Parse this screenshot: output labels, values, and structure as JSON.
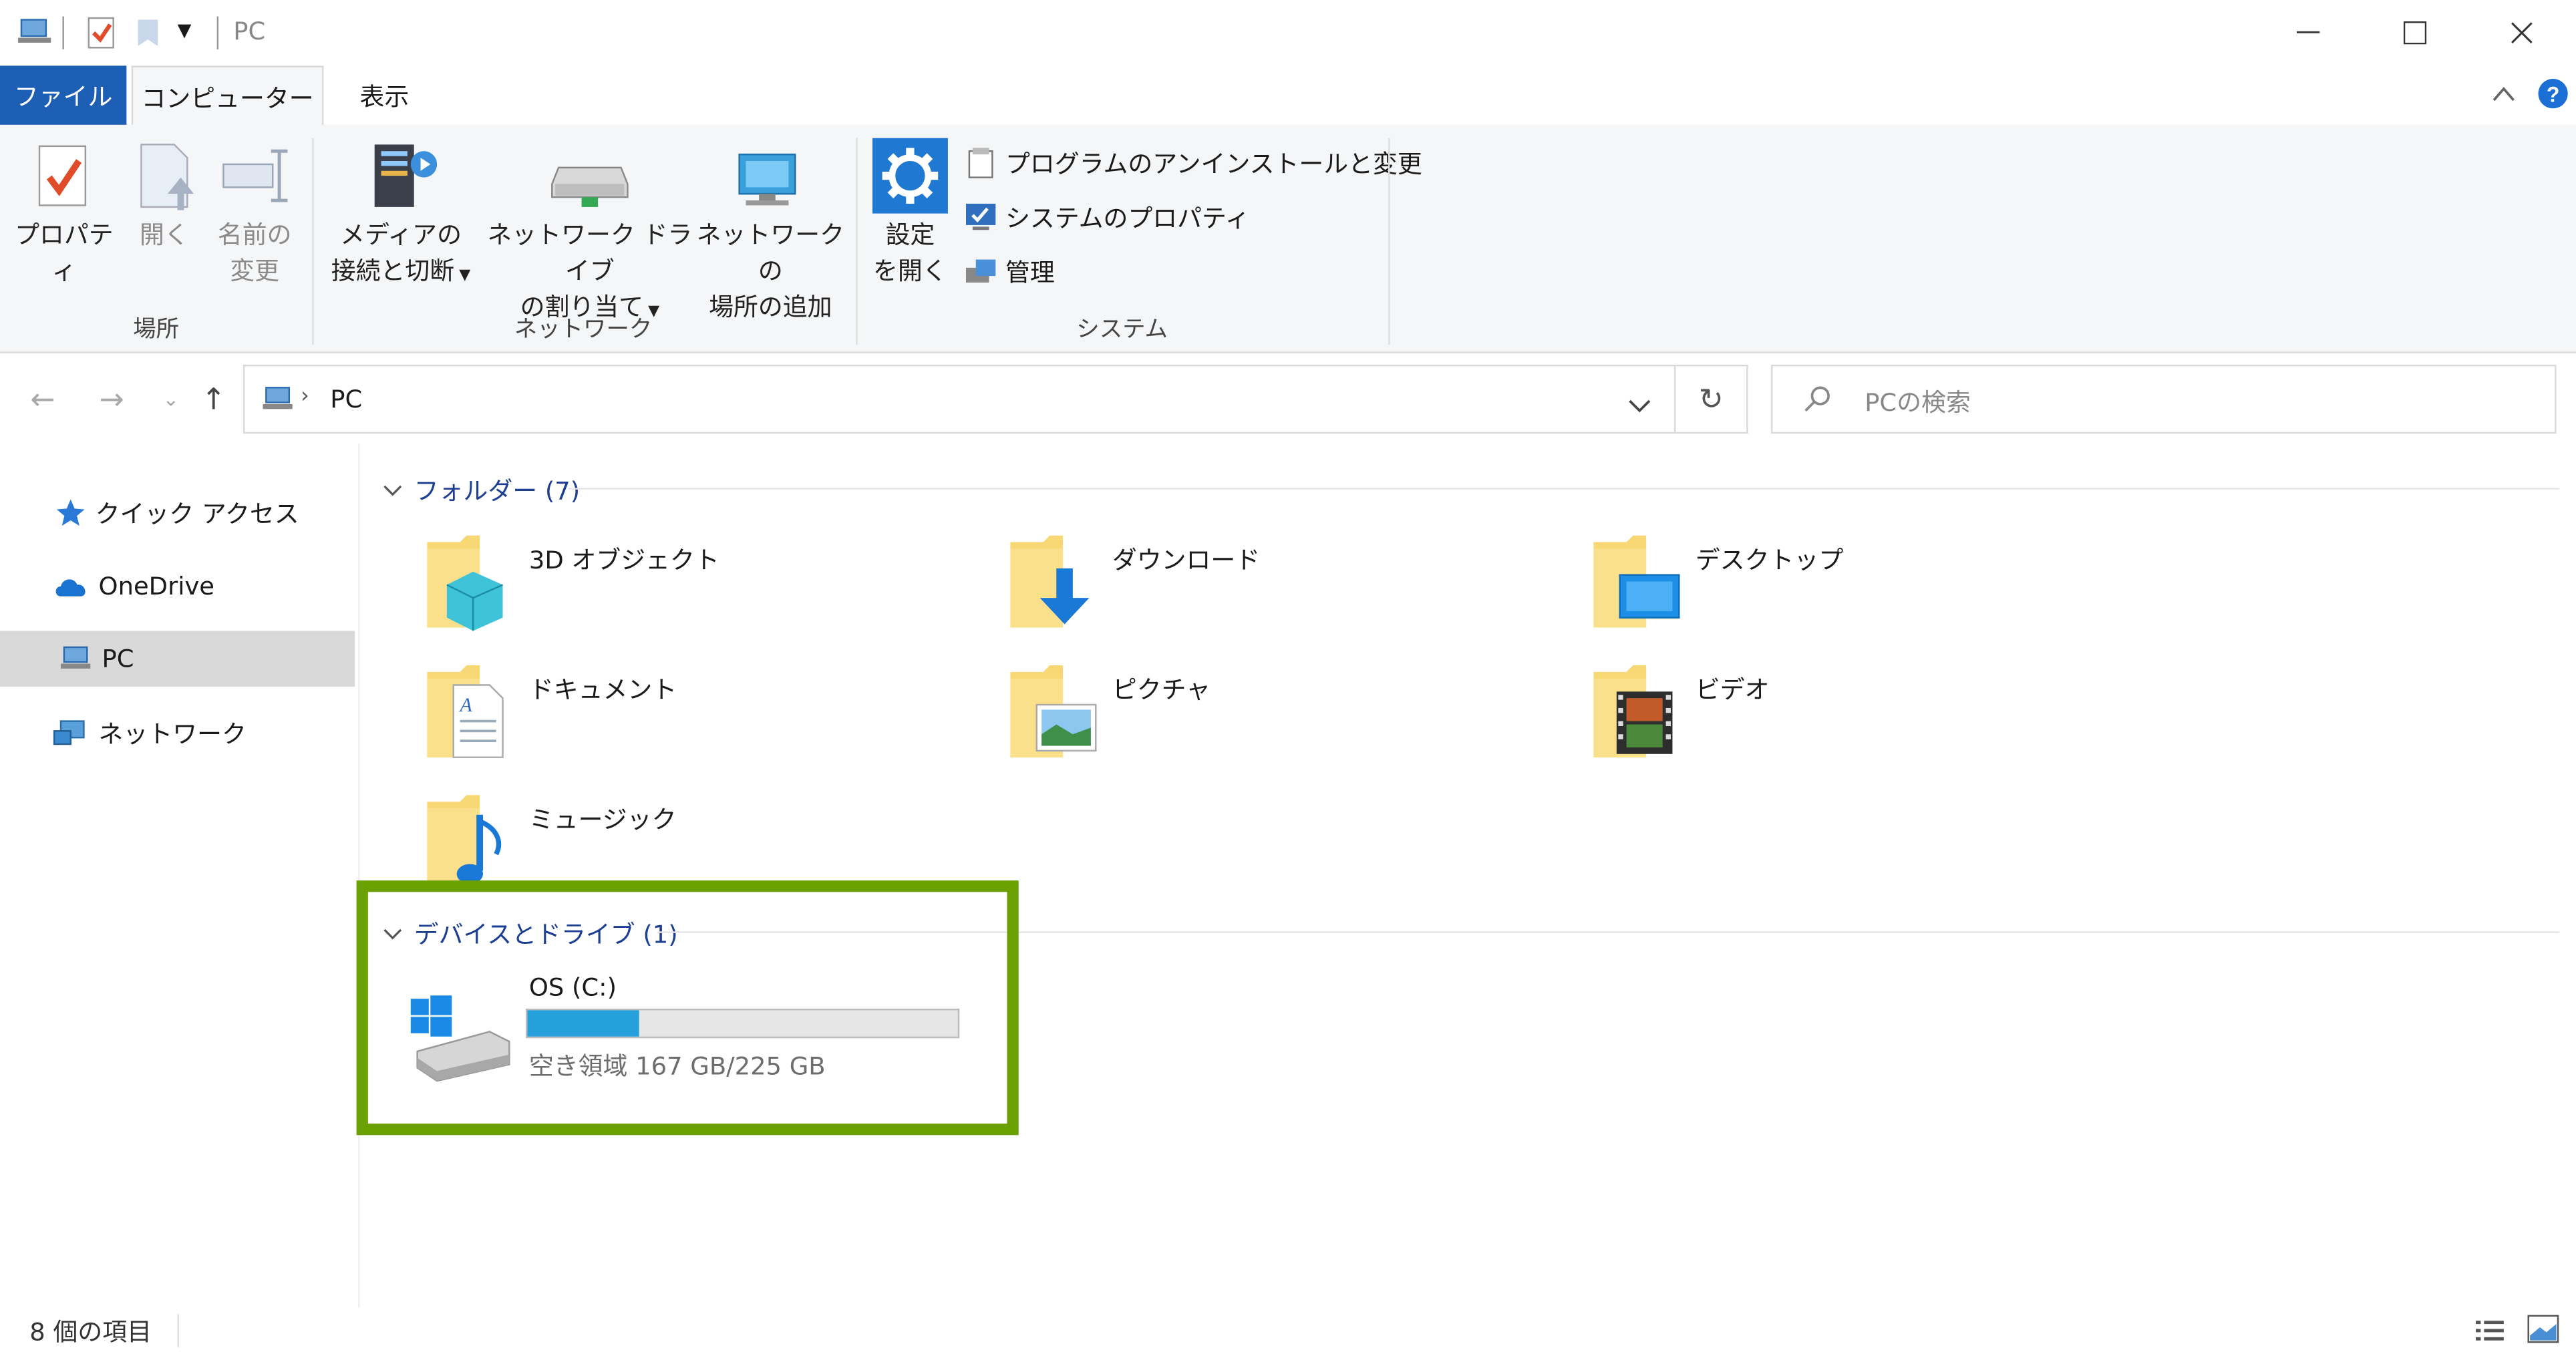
{
  "window": {
    "title": "PC"
  },
  "tabs": {
    "file": "ファイル",
    "computer": "コンピューター",
    "view": "表示"
  },
  "ribbon": {
    "properties": [
      "プロパティ"
    ],
    "open": [
      "開く"
    ],
    "rename": [
      "名前の",
      "変更"
    ],
    "media": [
      "メディアの",
      "接続と切断"
    ],
    "mapdrive": [
      "ネットワーク ドライブ",
      "の割り当て"
    ],
    "addnet": [
      "ネットワークの",
      "場所の追加"
    ],
    "settings": [
      "設定",
      "を開く"
    ],
    "uninstall": "プログラムのアンインストールと変更",
    "sysprops": "システムのプロパティ",
    "manage": "管理",
    "groups": {
      "location": "場所",
      "network": "ネットワーク",
      "system": "システム"
    }
  },
  "address": {
    "path": "PC",
    "search_placeholder": "PCの検索"
  },
  "nav": {
    "quick": "クイック アクセス",
    "onedrive": "OneDrive",
    "pc": "PC",
    "network": "ネットワーク"
  },
  "folders_header": "フォルダー (7)",
  "folders": [
    "3D オブジェクト",
    "ダウンロード",
    "デスクトップ",
    "ドキュメント",
    "ピクチャ",
    "ビデオ",
    "ミュージック"
  ],
  "devices_header": "デバイスとドライブ (1)",
  "drive": {
    "name": "OS (C:)",
    "free": "空き領域 167 GB/225 GB",
    "used_fraction": 0.258
  },
  "status": {
    "items": "8 個の項目"
  },
  "colors": {
    "accent": "#1c5fb4",
    "highlight_box": "#6aa100",
    "drive_bar": "#26a0da"
  }
}
